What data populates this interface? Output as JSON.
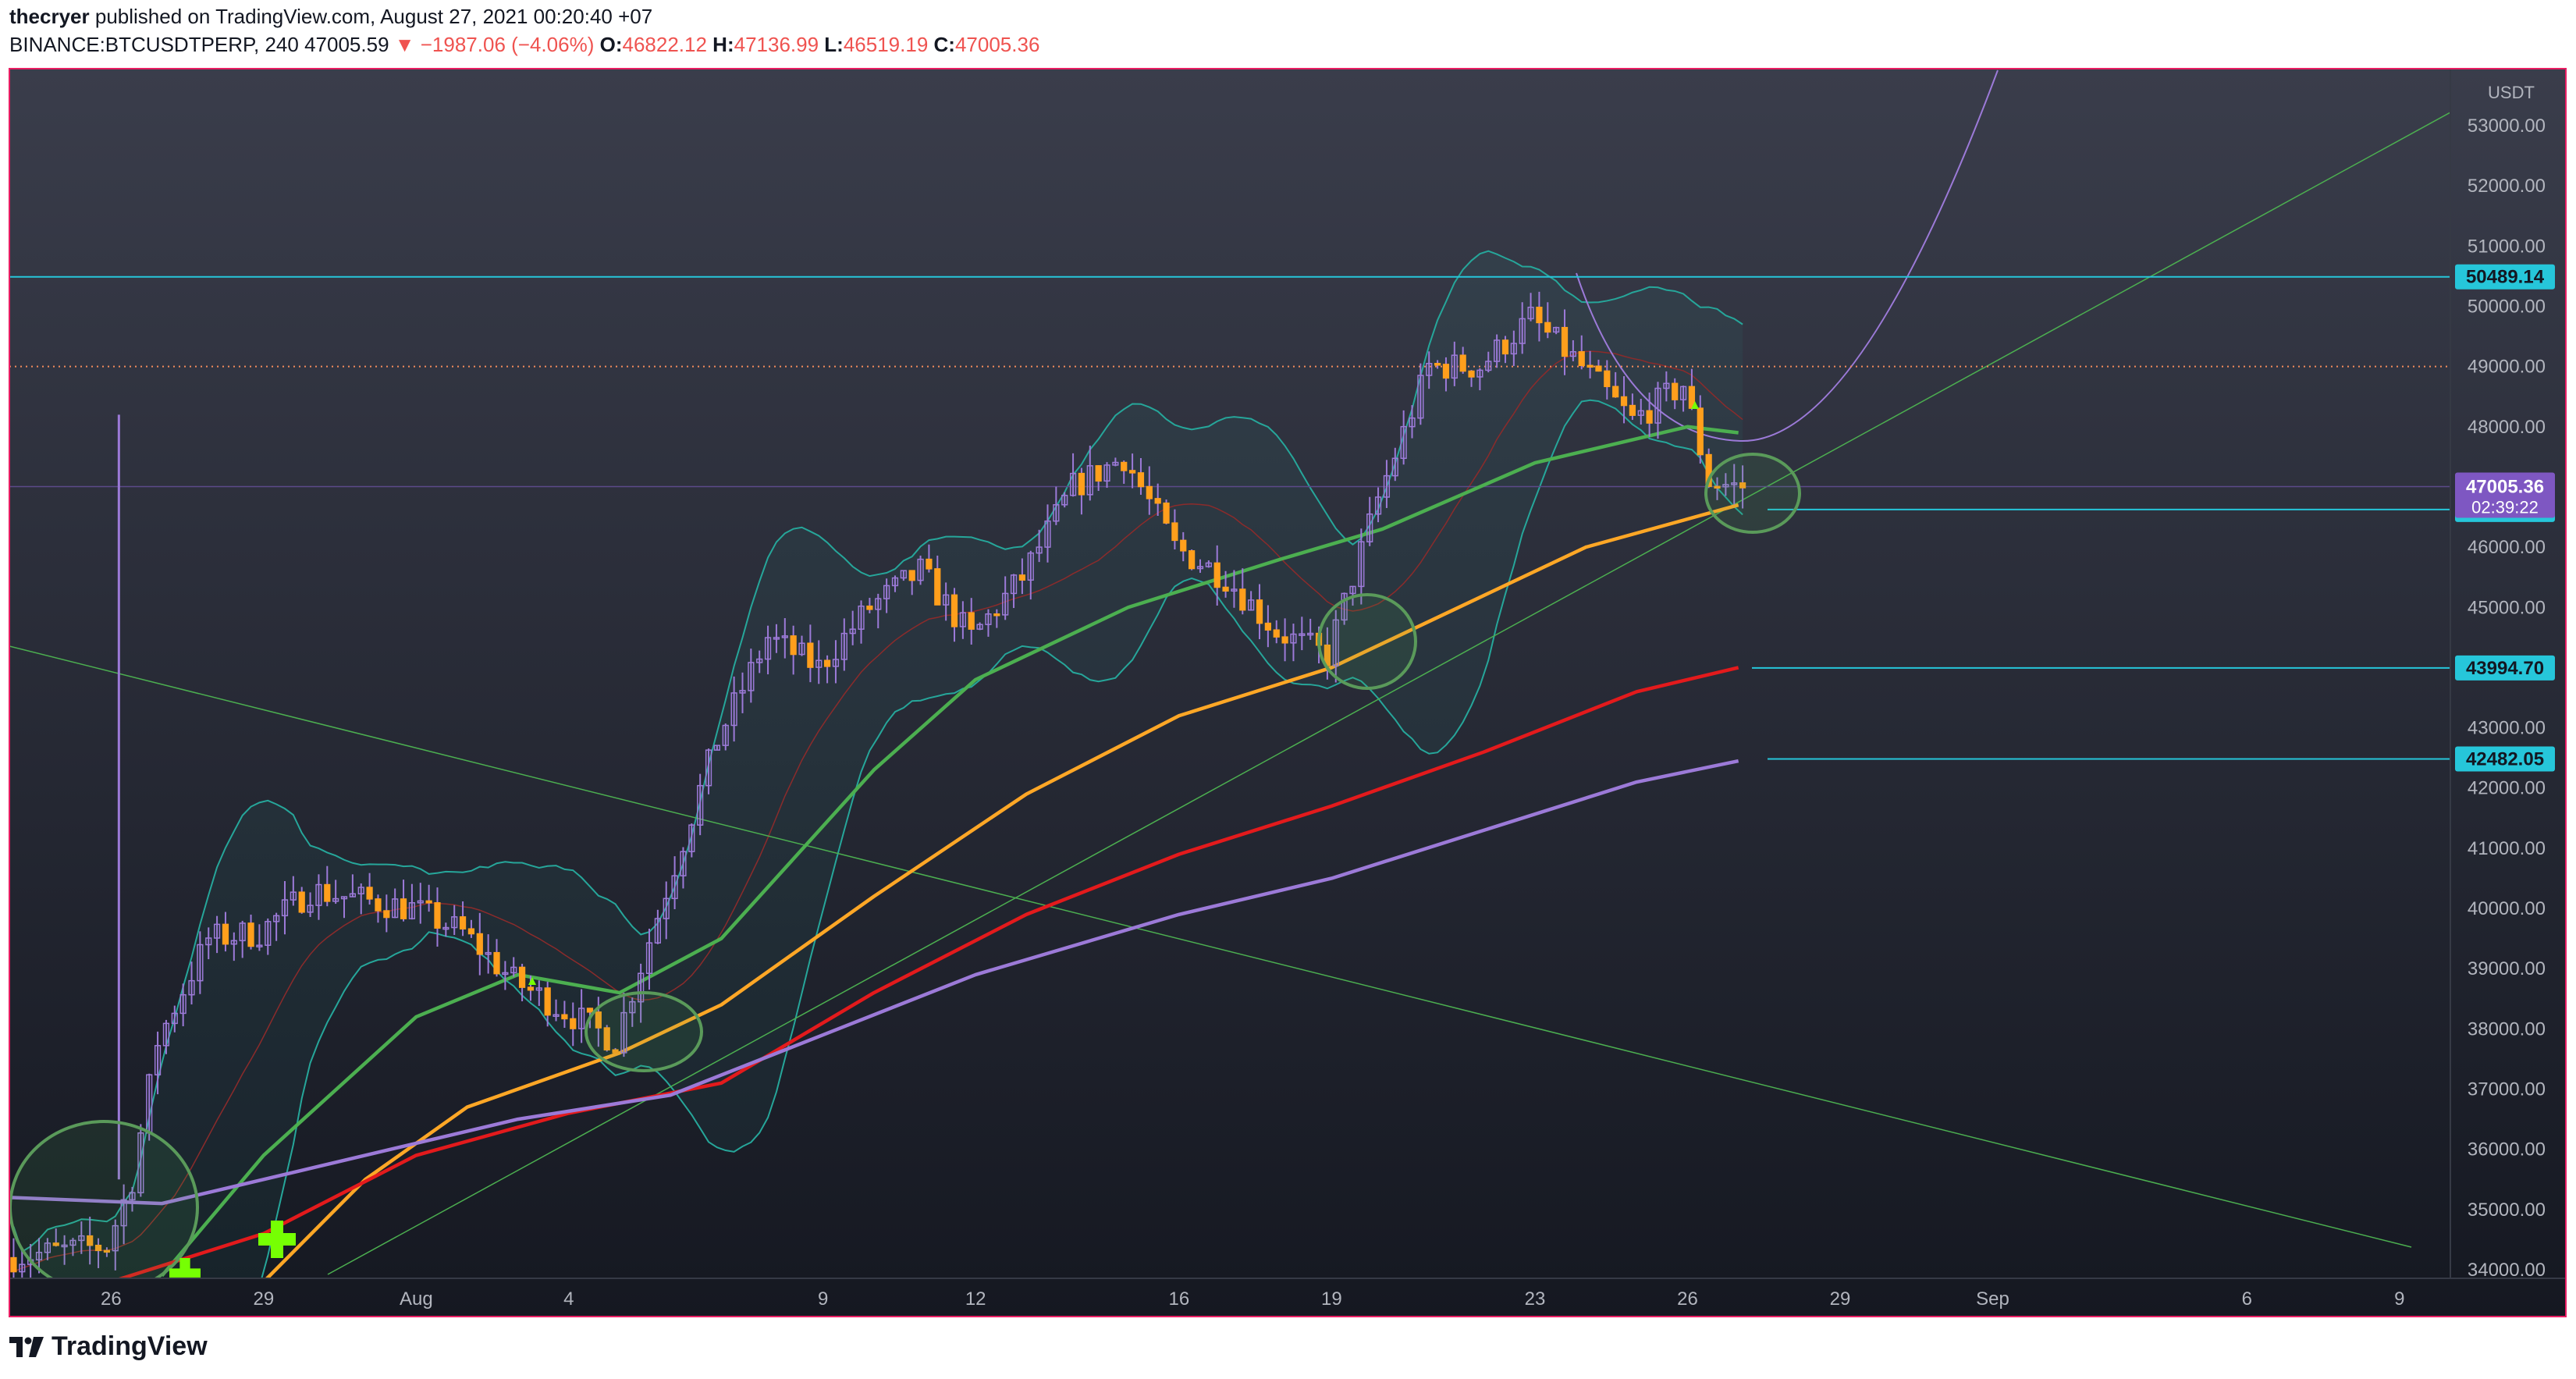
{
  "header": {
    "author": "thecryer",
    "published": "published on TradingView.com, August 27, 2021 00:20:40 +07",
    "symbol": "BINANCE:BTCUSDTPERP, 240",
    "last": "47005.59",
    "change": "▼ −1987.06 (−4.06%)",
    "o_label": "O:",
    "o": "46822.12",
    "h_label": "H:",
    "h": "47136.99",
    "l_label": "L:",
    "l": "46519.19",
    "c_label": "C:",
    "c": "47005.36"
  },
  "brand": "TradingView",
  "colors": {
    "background": "#1e222d",
    "candle": "#ff9f1c",
    "candle_wick": "#9c7ad8",
    "bollinger": "#26a69a",
    "ma_fast": "#4caf50",
    "ma_orange": "#ffa726",
    "ma_red": "#e31a1c",
    "ma_purple": "#9c7ad8",
    "level": "#26c6da",
    "frame": "#e91e63"
  },
  "chart_data": {
    "type": "candlestick",
    "currency": "USDT",
    "ylim": [
      33800,
      54000
    ],
    "y_ticks": [
      34000,
      35000,
      36000,
      37000,
      38000,
      39000,
      40000,
      41000,
      42000,
      43000,
      44000,
      45000,
      46000,
      47000,
      48000,
      49000,
      50000,
      51000,
      52000,
      53000
    ],
    "x_axis_labels": [
      "26",
      "29",
      "Aug",
      "4",
      "9",
      "12",
      "16",
      "19",
      "23",
      "26",
      "29",
      "Sep",
      "6",
      "9"
    ],
    "x_start": "2021-07-24",
    "x_end": "2021-09-10",
    "price_labels": {
      "current": "47005.36",
      "countdown": "02:39:22",
      "levels": [
        "50489.14",
        "46624.65",
        "43994.70",
        "42482.05"
      ]
    },
    "horizontal_levels": [
      50489.14,
      46624.65,
      43994.7,
      42482.05
    ],
    "dotted_level": 49000,
    "anchors": [
      [
        "2021-07-24",
        34200
      ],
      [
        "2021-07-26",
        34400
      ],
      [
        "2021-07-26",
        35500
      ],
      [
        "2021-07-27",
        37800
      ],
      [
        "2021-07-28",
        39500
      ],
      [
        "2021-07-29",
        39600
      ],
      [
        "2021-07-30",
        40300
      ],
      [
        "2021-08-01",
        40000
      ],
      [
        "2021-08-02",
        39600
      ],
      [
        "2021-08-03",
        38800
      ],
      [
        "2021-08-04",
        38300
      ],
      [
        "2021-08-05",
        37800
      ],
      [
        "2021-08-06",
        40300
      ],
      [
        "2021-08-07",
        42800
      ],
      [
        "2021-08-08",
        44500
      ],
      [
        "2021-08-09",
        44000
      ],
      [
        "2021-08-10",
        45000
      ],
      [
        "2021-08-11",
        45600
      ],
      [
        "2021-08-12",
        44500
      ],
      [
        "2021-08-13",
        45500
      ],
      [
        "2021-08-14",
        47000
      ],
      [
        "2021-08-15",
        47500
      ],
      [
        "2021-08-16",
        46000
      ],
      [
        "2021-08-17",
        45500
      ],
      [
        "2021-08-18",
        44600
      ],
      [
        "2021-08-19",
        44200
      ],
      [
        "2021-08-20",
        46800
      ],
      [
        "2021-08-21",
        49000
      ],
      [
        "2021-08-22",
        49000
      ],
      [
        "2021-08-23",
        49800
      ],
      [
        "2021-08-24",
        49000
      ],
      [
        "2021-08-25",
        48100
      ],
      [
        "2021-08-26",
        48700
      ],
      [
        "2021-08-26",
        47100
      ],
      [
        "2021-08-27",
        47005
      ]
    ],
    "moving_averages": [
      {
        "color": "ma_fast",
        "points": [
          [
            "2021-07-27",
            33900
          ],
          [
            "2021-07-29",
            35900
          ],
          [
            "2021-08-01",
            38200
          ],
          [
            "2021-08-03",
            38900
          ],
          [
            "2021-08-05",
            38600
          ],
          [
            "2021-08-07",
            39500
          ],
          [
            "2021-08-10",
            42300
          ],
          [
            "2021-08-12",
            43800
          ],
          [
            "2021-08-15",
            45000
          ],
          [
            "2021-08-18",
            45800
          ],
          [
            "2021-08-20",
            46300
          ],
          [
            "2021-08-23",
            47400
          ],
          [
            "2021-08-26",
            48000
          ],
          [
            "2021-08-27",
            47900
          ]
        ]
      },
      {
        "color": "ma_orange",
        "points": [
          [
            "2021-07-29",
            33800
          ],
          [
            "2021-07-31",
            35500
          ],
          [
            "2021-08-02",
            36700
          ],
          [
            "2021-08-05",
            37600
          ],
          [
            "2021-08-07",
            38400
          ],
          [
            "2021-08-10",
            40200
          ],
          [
            "2021-08-13",
            41900
          ],
          [
            "2021-08-16",
            43200
          ],
          [
            "2021-08-19",
            44000
          ],
          [
            "2021-08-21",
            44800
          ],
          [
            "2021-08-24",
            46000
          ],
          [
            "2021-08-27",
            46700
          ]
        ]
      },
      {
        "color": "ma_red",
        "points": [
          [
            "2021-07-26",
            33800
          ],
          [
            "2021-07-29",
            34600
          ],
          [
            "2021-08-01",
            35900
          ],
          [
            "2021-08-04",
            36600
          ],
          [
            "2021-08-07",
            37100
          ],
          [
            "2021-08-10",
            38600
          ],
          [
            "2021-08-13",
            39900
          ],
          [
            "2021-08-16",
            40900
          ],
          [
            "2021-08-19",
            41700
          ],
          [
            "2021-08-22",
            42600
          ],
          [
            "2021-08-25",
            43600
          ],
          [
            "2021-08-27",
            44000
          ]
        ]
      },
      {
        "color": "ma_purple",
        "points": [
          [
            "2021-07-24",
            35200
          ],
          [
            "2021-07-27",
            35100
          ],
          [
            "2021-07-30",
            35700
          ],
          [
            "2021-08-03",
            36500
          ],
          [
            "2021-08-06",
            36900
          ],
          [
            "2021-08-09",
            37900
          ],
          [
            "2021-08-12",
            38900
          ],
          [
            "2021-08-16",
            39900
          ],
          [
            "2021-08-19",
            40500
          ],
          [
            "2021-08-22",
            41300
          ],
          [
            "2021-08-25",
            42100
          ],
          [
            "2021-08-27",
            42450
          ]
        ]
      }
    ]
  }
}
